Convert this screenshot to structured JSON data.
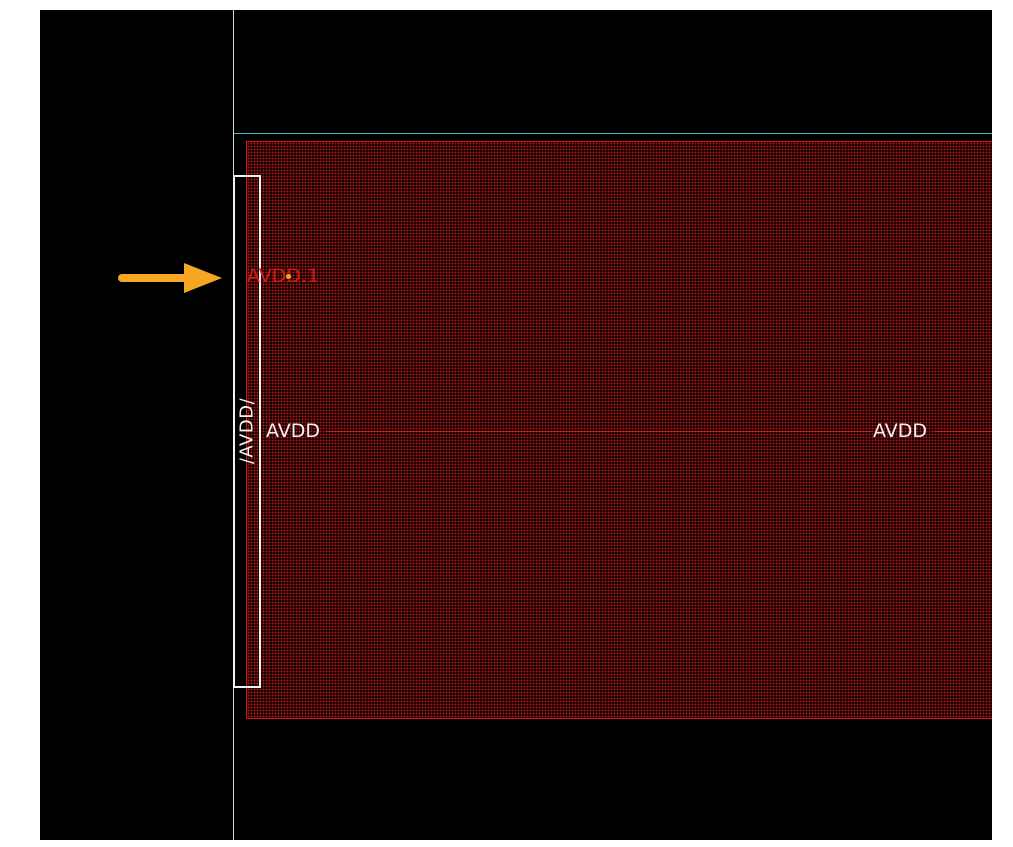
{
  "viewport": {
    "background": "#000000",
    "region_color": "#d11a1a",
    "boundary_color": "#3fb7c9",
    "pin_color": "#f2f2f2",
    "arrow_color": "#f5a623"
  },
  "pin": {
    "label": "/AVDD/"
  },
  "net": {
    "left_label": "AVDD",
    "right_label": "AVDD"
  },
  "instance": {
    "label": "AVDD.1"
  },
  "annotation": {
    "icon": "arrow-right-icon"
  }
}
